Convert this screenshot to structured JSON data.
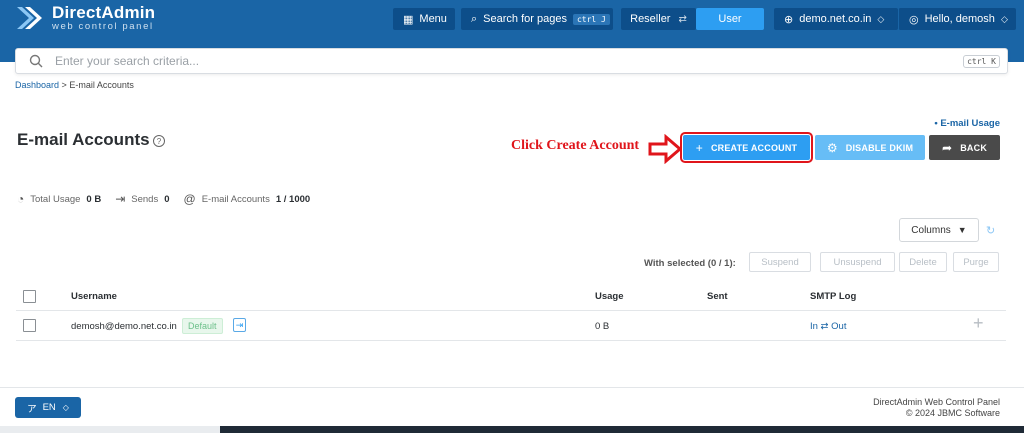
{
  "header": {
    "logo_title": "DirectAdmin",
    "logo_subtitle": "web control panel",
    "menu_label": "Menu",
    "search_pages_label": "Search for pages",
    "search_shortcut": "ctrl J",
    "reseller_label": "Reseller",
    "user_label": "User",
    "domain_label": "demo.net.co.in",
    "hello_label": "Hello, demosh"
  },
  "search": {
    "placeholder": "Enter your search criteria...",
    "shortcut": "ctrl K"
  },
  "breadcrumb": {
    "home": "Dashboard",
    "separator": ">",
    "current": "E-mail Accounts"
  },
  "page": {
    "title": "E-mail Accounts",
    "usage_link": "• E-mail Usage"
  },
  "annotation": {
    "text": "Click Create Account",
    "color": "#e0151b"
  },
  "actions": {
    "create": "CREATE ACCOUNT",
    "dkim": "DISABLE DKIM",
    "back": "BACK"
  },
  "stats": {
    "total_usage_label": "Total Usage",
    "total_usage_value": "0 B",
    "sends_label": "Sends",
    "sends_value": "0",
    "accounts_label": "E-mail Accounts",
    "accounts_value": "1 / 1000"
  },
  "table_controls": {
    "columns_label": "Columns",
    "with_selected": "With selected (0 / 1):",
    "suspend": "Suspend",
    "unsuspend": "Unsuspend",
    "delete": "Delete",
    "purge": "Purge"
  },
  "table": {
    "headers": {
      "username": "Username",
      "usage": "Usage",
      "sent": "Sent",
      "smtp_log": "SMTP Log"
    },
    "rows": [
      {
        "username": "demosh@demo.net.co.in",
        "badge": "Default",
        "usage": "0 B",
        "sent": "",
        "smtp_log": "In ⇄ Out"
      }
    ]
  },
  "footer": {
    "lang_label": "EN",
    "line1": "DirectAdmin Web Control Panel",
    "line2": "© 2024 JBMC Software"
  },
  "colors": {
    "primary": "#1a65a6",
    "accent": "#2d9ef2",
    "dark_button": "#4a4a4a"
  }
}
